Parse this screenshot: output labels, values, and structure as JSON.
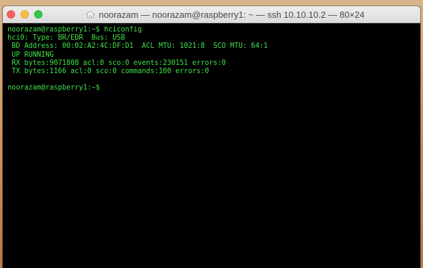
{
  "window": {
    "title": "noorazam — noorazam@raspberry1: ~ — ssh 10.10.10.2 — 80×24",
    "icon": "home-folder-icon"
  },
  "colors": {
    "terminal_bg": "#000000",
    "terminal_text": "#3fe24a",
    "close": "#fc605c",
    "minimize": "#fdbc40",
    "maximize": "#34c84a"
  },
  "terminal": {
    "lines": [
      "noorazam@raspberry1:~$ hciconfig",
      "hci0:\tType: BR/EDR  Bus: USB",
      "\tBD Address: 00:02:A2:4C:DF:D1  ACL MTU: 1021:8  SCO MTU: 64:1",
      "\tUP RUNNING",
      "\tRX bytes:9071808 acl:0 sco:0 events:230151 errors:0",
      "\tTX bytes:1166 acl:0 sco:0 commands:100 errors:0",
      "",
      "noorazam@raspberry1:~$"
    ]
  }
}
